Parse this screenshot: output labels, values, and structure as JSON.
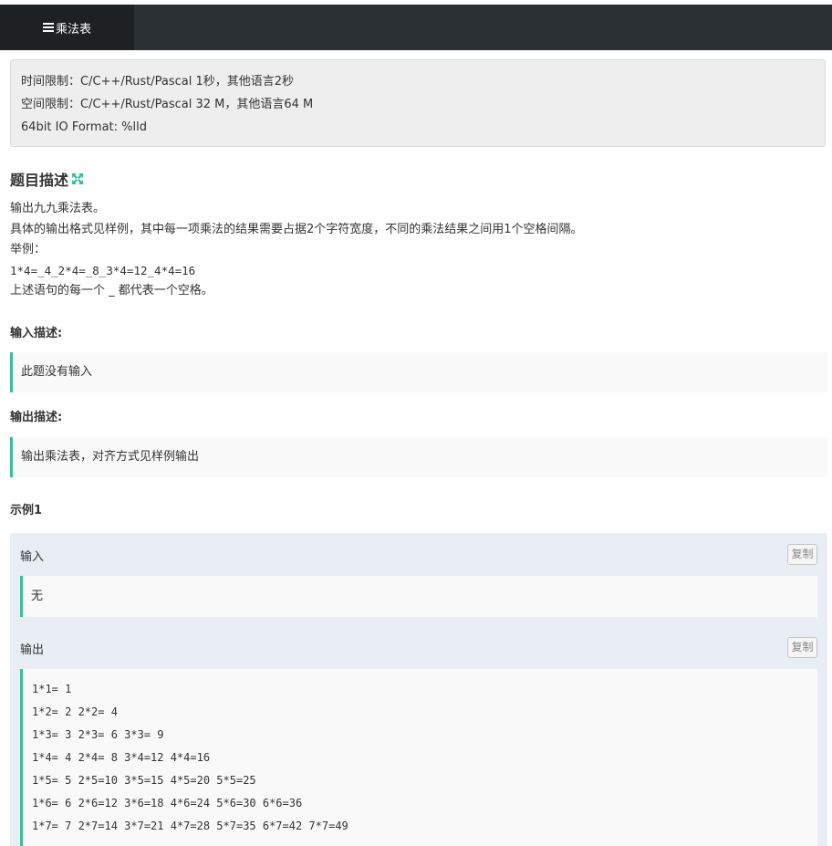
{
  "topbar": {
    "tab_label": "乘法表",
    "tab_icon": "list-icon"
  },
  "limits": {
    "time": "时间限制：C/C++/Rust/Pascal 1秒，其他语言2秒",
    "space": "空间限制：C/C++/Rust/Pascal 32 M，其他语言64 M",
    "io_format": "64bit IO Format: %lld"
  },
  "description": {
    "title": "题目描述",
    "expand_icon": "expand-icon",
    "line1": "输出九九乘法表。",
    "line2": "具体的输出格式见样例，其中每一项乘法的结果需要占据2个字符宽度，不同的乘法结果之间用1个空格间隔。",
    "line3": "举例：",
    "line4": "1*4=_4_2*4=_8_3*4=12_4*4=16",
    "line5": "上述语句的每一个 _ 都代表一个空格。"
  },
  "input_desc": {
    "title": "输入描述:",
    "text": "此题没有输入"
  },
  "output_desc": {
    "title": "输出描述:",
    "text": "输出乘法表，对齐方式见样例输出"
  },
  "example": {
    "title": "示例1",
    "input_label": "输入",
    "input_value": "无",
    "output_label": "输出",
    "copy_label": "复制",
    "output_rows": [
      "1*1= 1",
      "1*2= 2 2*2= 4",
      "1*3= 3 2*3= 6 3*3= 9",
      "1*4= 4 2*4= 8 3*4=12 4*4=16",
      "1*5= 5 2*5=10 3*5=15 4*5=20 5*5=25",
      "1*6= 6 2*6=12 3*6=18 4*6=24 5*6=30 6*6=36",
      "1*7= 7 2*7=14 3*7=21 4*7=28 5*7=35 6*7=42 7*7=49"
    ]
  },
  "colors": {
    "topbar_bg": "#2b3035",
    "active_tab_bg": "#1d2124",
    "accent_green": "#3bbd9c",
    "example_bg": "#e9eef5"
  }
}
